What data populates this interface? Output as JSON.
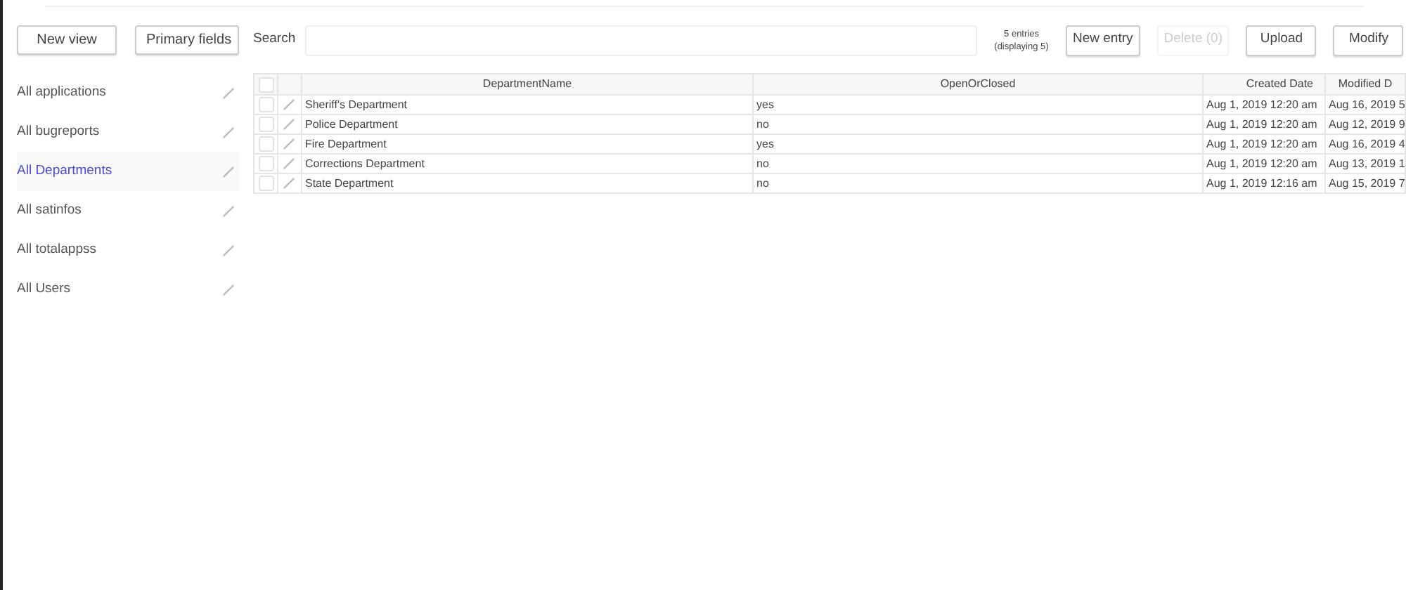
{
  "sidebar": {
    "buttons": [
      "New view",
      "Primary fields"
    ],
    "items": [
      {
        "label": "All applications",
        "selected": false
      },
      {
        "label": "All bugreports",
        "selected": false
      },
      {
        "label": "All Departments",
        "selected": true
      },
      {
        "label": "All satinfos",
        "selected": false
      },
      {
        "label": "All totalappss",
        "selected": false
      },
      {
        "label": "All Users",
        "selected": false
      }
    ]
  },
  "toolbar": {
    "search_label": "Search",
    "entries": [
      "5 entries",
      "(displaying 5)"
    ],
    "buttons": [
      {
        "label": "New entry",
        "disabled": false
      },
      {
        "label": "Delete (0)",
        "disabled": true
      },
      {
        "label": "Upload",
        "disabled": false
      },
      {
        "label": "Modify",
        "disabled": false
      }
    ]
  },
  "table": {
    "all_checked": false,
    "columns": [
      "DepartmentName",
      "OpenOrClosed",
      "Created Date",
      "Modified D"
    ],
    "rows": [
      {
        "checked": false,
        "cells": [
          "Sheriff's Department",
          "yes",
          "Aug 1, 2019 12:20 am",
          "Aug 16, 2019 5"
        ]
      },
      {
        "checked": false,
        "cells": [
          "Police Department",
          "no",
          "Aug 1, 2019 12:20 am",
          "Aug 12, 2019 9"
        ]
      },
      {
        "checked": false,
        "cells": [
          "Fire Department",
          "yes",
          "Aug 1, 2019 12:20 am",
          "Aug 16, 2019 4"
        ]
      },
      {
        "checked": false,
        "cells": [
          "Corrections Department",
          "no",
          "Aug 1, 2019 12:20 am",
          "Aug 13, 2019 1"
        ]
      },
      {
        "checked": false,
        "cells": [
          "State Department",
          "no",
          "Aug 1, 2019 12:16 am",
          "Aug 15, 2019 7"
        ]
      }
    ]
  }
}
